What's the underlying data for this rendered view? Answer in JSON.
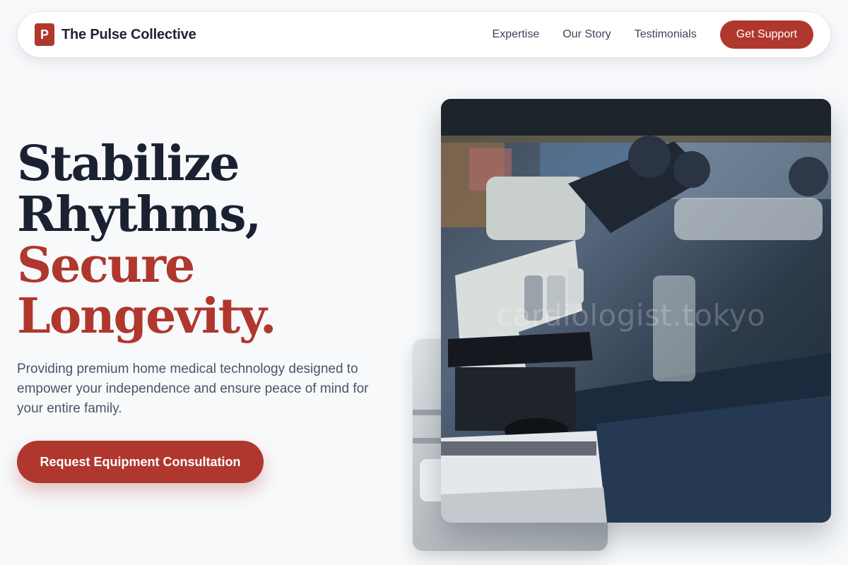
{
  "brand": {
    "badge_letter": "P",
    "name": "The Pulse Collective",
    "accent_color": "#b0372d"
  },
  "nav": {
    "links": [
      "Expertise",
      "Our Story",
      "Testimonials"
    ],
    "cta_label": "Get Support"
  },
  "hero": {
    "title_line1": "Stabilize",
    "title_line2": "Rhythms,",
    "title_line3": "Secure",
    "title_line4": "Longevity.",
    "subtitle": "Providing premium home medical technology designed to empower your independence and ensure peace of mind for your entire family.",
    "cta_label": "Request Equipment Consultation"
  },
  "images": {
    "main_watermark": "cardiologist.tokyo"
  }
}
